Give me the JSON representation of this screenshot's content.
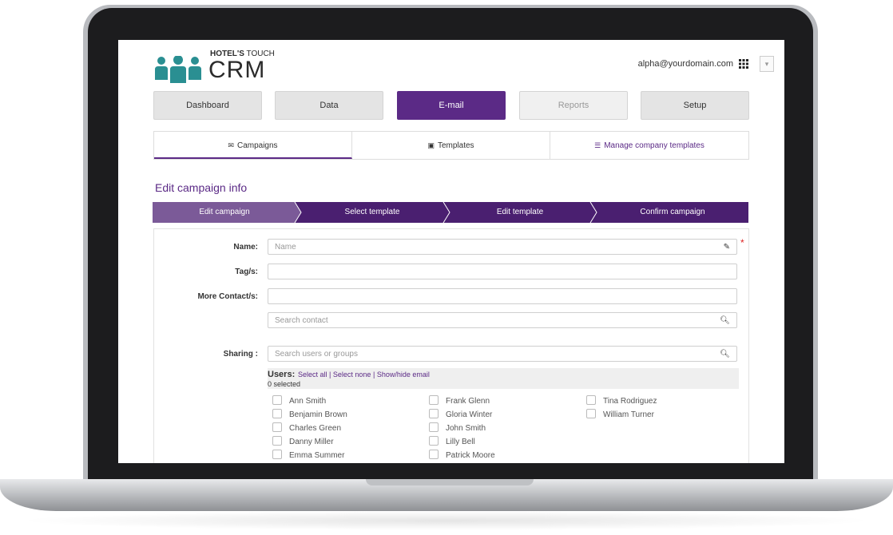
{
  "header": {
    "logo_brand": "HOTEL'S",
    "logo_brand_rest": " TOUCH",
    "logo_product": "CRM",
    "account_email": "alpha@yourdomain.com"
  },
  "nav": {
    "items": [
      {
        "label": "Dashboard"
      },
      {
        "label": "Data"
      },
      {
        "label": "E-mail"
      },
      {
        "label": "Reports"
      },
      {
        "label": "Setup"
      }
    ],
    "active": "E-mail",
    "disabled": "Reports"
  },
  "subtabs": {
    "items": [
      {
        "label": "Campaigns",
        "icon": "envelope-icon"
      },
      {
        "label": "Templates",
        "icon": "image-icon"
      },
      {
        "label": "Manage company templates",
        "icon": "list-icon"
      }
    ],
    "active": "Campaigns"
  },
  "page_title": "Edit campaign info",
  "steps": {
    "items": [
      {
        "label": "Edit campaign"
      },
      {
        "label": "Select template"
      },
      {
        "label": "Edit template"
      },
      {
        "label": "Confirm campaign"
      }
    ],
    "current": "Edit campaign"
  },
  "form": {
    "name_label": "Name:",
    "name_placeholder": "Name",
    "tags_label": "Tag/s:",
    "contacts_label": "More Contact/s:",
    "search_contact_placeholder": "Search contact",
    "sharing_label": "Sharing :",
    "search_users_placeholder": "Search users or groups",
    "required_mark": "*"
  },
  "users": {
    "title": "Users:",
    "select_all": "Select all",
    "select_none": "Select none",
    "show_hide_email": "Show/hide email",
    "separator": "|",
    "count": "0 selected",
    "columns": [
      [
        "Ann Smith",
        "Benjamin Brown",
        "Charles Green",
        "Danny  Miller",
        "Emma Summer"
      ],
      [
        "Frank Glenn",
        "Gloria Winter",
        "John Smith",
        "Lilly Bell",
        "Patrick Moore"
      ],
      [
        "Tina Rodriguez",
        "William Turner"
      ]
    ]
  },
  "colors": {
    "accent": "#5b2a86",
    "step_active": "#7b5a98",
    "step_inactive": "#4a1f70",
    "logo_teal": "#2a8f92"
  }
}
